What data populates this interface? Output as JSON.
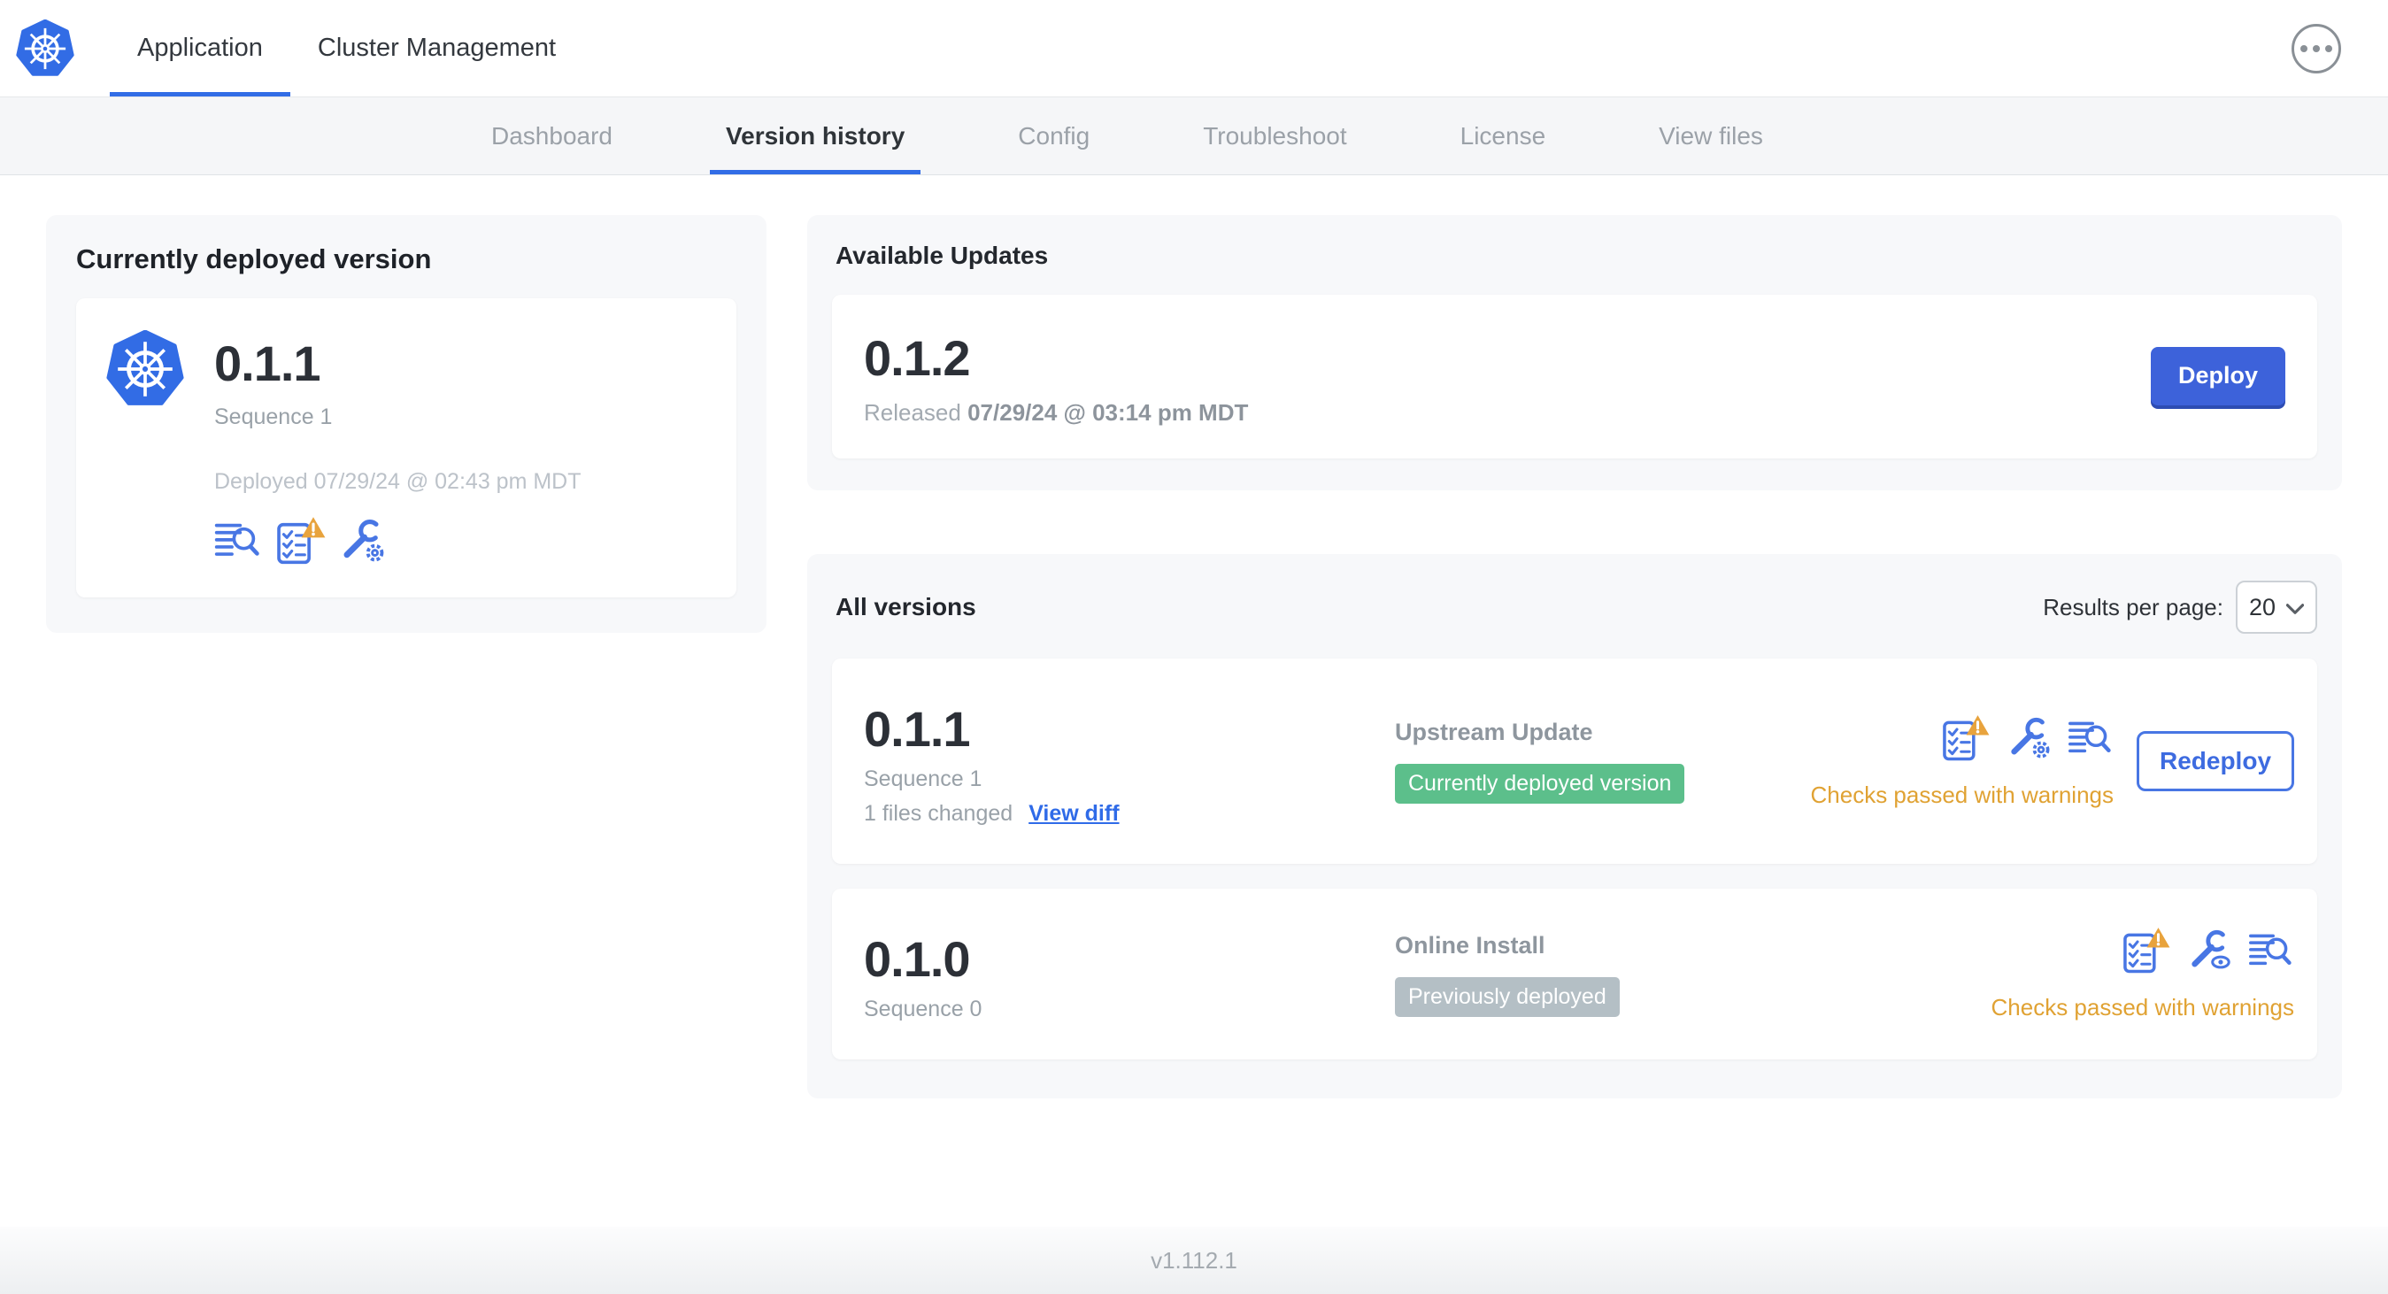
{
  "topnav": {
    "tabs": [
      {
        "label": "Application",
        "active": true
      },
      {
        "label": "Cluster Management",
        "active": false
      }
    ]
  },
  "subnav": {
    "tabs": [
      {
        "label": "Dashboard",
        "active": false
      },
      {
        "label": "Version history",
        "active": true
      },
      {
        "label": "Config",
        "active": false
      },
      {
        "label": "Troubleshoot",
        "active": false
      },
      {
        "label": "License",
        "active": false
      },
      {
        "label": "View files",
        "active": false
      }
    ]
  },
  "deployed_card": {
    "title": "Currently deployed version",
    "version": "0.1.1",
    "sequence": "Sequence 1",
    "deployed": "Deployed 07/29/24 @ 02:43 pm MDT"
  },
  "available_updates": {
    "title": "Available Updates",
    "version": "0.1.2",
    "released_label": "Released",
    "released_date": "07/29/24 @ 03:14 pm MDT",
    "deploy_label": "Deploy"
  },
  "all_versions": {
    "title": "All versions",
    "results_label": "Results per page:",
    "results_value": "20",
    "rows": [
      {
        "version": "0.1.1",
        "sequence": "Sequence 1",
        "files_changed": "1 files changed",
        "view_diff_label": "View diff",
        "source": "Upstream Update",
        "status_badge": "Currently deployed version",
        "checks": "Checks passed with warnings",
        "action_label": "Redeploy"
      },
      {
        "version": "0.1.0",
        "sequence": "Sequence 0",
        "source": "Online Install",
        "status_badge": "Previously deployed",
        "checks": "Checks passed with warnings"
      }
    ]
  },
  "footer": {
    "app_version": "v1.112.1"
  },
  "icons": {
    "kubernetes-logo": "blue heptagon with white helm wheel",
    "ellipsis-menu-icon": "circled three dots",
    "diff-log-icon": "text lines with magnifier",
    "preflight-warning-icon": "checklist with amber warning triangle",
    "config-edit-icon": "wrench with gear",
    "config-view-icon": "wrench with eye",
    "chevron-down-icon": "select dropdown chevron"
  },
  "colors": {
    "accent_blue": "#326de6",
    "icon_blue": "#4876e4",
    "deploy_button_blue": "#3d62da",
    "badge_green": "#5cbf8b",
    "badge_gray": "#b4bfc5",
    "warning_amber": "#e0a233",
    "panel_gray": "#f7f8fa"
  }
}
